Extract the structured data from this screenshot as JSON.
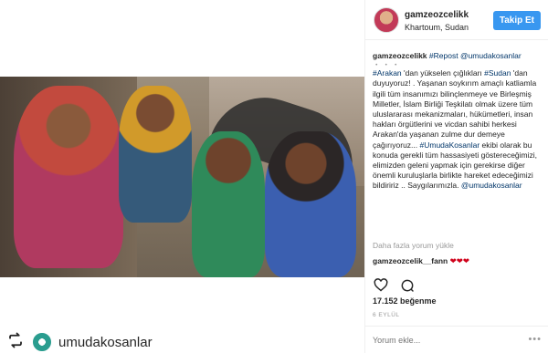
{
  "post": {
    "username": "gamzeozcelikk",
    "location": "Khartoum, Sudan",
    "follow_label": "Takip Et",
    "caption": {
      "user": "gamzeozcelikk",
      "repost_tag": "#Repost",
      "repost_mention": "@umudakosanlar",
      "dots": "・・・",
      "tag_arakan": "#Arakan",
      "t1": " 'dan yükselen çığlıkları ",
      "tag_sudan": "#Sudan",
      "t2": " 'dan duyuyoruz! . Yaşanan soykırım amaçlı katliamla ilgili tüm insanımızı bilinçlenmeye ve Birleşmiş Milletler, İslam Birliği Teşkilatı olmak üzere tüm uluslararası mekanizmaları, hükümetleri, insan hakları örgütlerini ve vicdan sahibi herkesi Arakan'da yaşanan zulme dur demeye çağırıyoruz... ",
      "tag_umuda": "#UmudaKosanlar",
      "t3": " ekibi olarak bu konuda gerekli tüm hassasiyeti göstereceğimizi, elimizden geleni yapmak için gerekirse diğer önemli kuruluşlarla birlikte hareket edeceğimizi bildiririz .. Saygılarımızla. ",
      "mention_end": "@umudakosanlar"
    },
    "more_comments": "Daha fazla yorum yükle",
    "comment": {
      "user": "gamzeozcelik__fann",
      "text": "❤❤❤"
    },
    "likes": "17.152 beğenme",
    "date": "6 EYLÜL",
    "comment_placeholder": "Yorum ekle...",
    "more_options": "•••"
  },
  "repost": {
    "icon": "repost-icon",
    "username": "umudakosanlar"
  },
  "colors": {
    "accent": "#3897f0",
    "hashtag": "#003569",
    "heart": "#d0021b"
  }
}
